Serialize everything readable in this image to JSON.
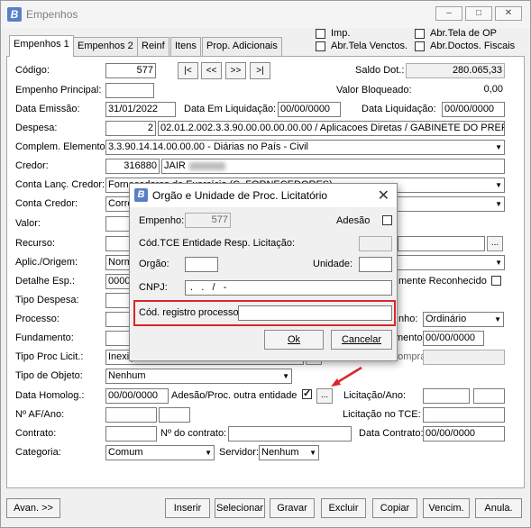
{
  "window": {
    "title": "Empenhos"
  },
  "top_checks": {
    "imp": "Imp.",
    "tela_vencto": "Abr.Tela Venctos.",
    "tela_op": "Abr.Tela de OP",
    "doctos_fiscais": "Abr.Doctos. Fiscais"
  },
  "tabs": [
    "Empenhos 1",
    "Empenhos 2",
    "Reinf",
    "Itens",
    "Prop. Adicionais"
  ],
  "form": {
    "codigo_label": "Código:",
    "codigo": "577",
    "nav": [
      "|<",
      "<<",
      ">>",
      ">|"
    ],
    "saldo_dot_label": "Saldo Dot.:",
    "saldo_dot": "280.065,33",
    "empenho_principal_label": "Empenho Principal:",
    "valor_bloqueado_label": "Valor Bloqueado:",
    "valor_bloqueado": "0,00",
    "data_emissao_label": "Data Emissão:",
    "data_emissao": "31/01/2022",
    "data_em_liquidacao_label": "Data Em Liquidação:",
    "data_em_liquidacao": "00/00/0000",
    "data_liquidacao_label": "Data Liquidação:",
    "data_liquidacao": "00/00/0000",
    "despesa_label": "Despesa:",
    "despesa_code": "2",
    "despesa_desc": "02.01.2.002.3.3.90.00.00.00.00.00 / Aplicacoes Diretas / GABINETE DO PREFI",
    "complem_label": "Complem. Elemento:",
    "complem": "3.3.90.14.14.00.00.00 - Diárias no País - Civil",
    "credor_label": "Credor:",
    "credor_code": "316880",
    "credor_name": "JAIR",
    "conta_lanc_label": "Conta Lanç. Credor:",
    "conta_lanc": "Fornecedores de Exercício (C. FORNECEDORES)",
    "conta_credor_label": "Conta Credor:",
    "conta_credor": "Corre",
    "valor_label": "Valor:",
    "recurso_label": "Recurso:",
    "aplic_label": "Aplic./Origem:",
    "aplic": "Norm",
    "detalhe_label": "Detalhe Esp.:",
    "detalhe": "0000",
    "reconhecido_label": "mente Reconhecido",
    "tipo_despesa_label": "Tipo Despesa:",
    "processo_label": "Processo:",
    "ordenamento_label": "nho:",
    "ordenamento": "Ordinário",
    "fundamento_label": "Fundamento:",
    "mento_label": "mento:",
    "mento_date": "00/00/0000",
    "tipo_proc_label": "Tipo Proc Licit.:",
    "tipo_proc": "Inexig",
    "compra_label": "Processo de Compra:",
    "tipo_objeto_label": "Tipo de Objeto:",
    "tipo_objeto": "Nenhum",
    "data_homolog_label": "Data Homolog.:",
    "data_homolog": "00/00/0000",
    "adesao_label": "Adesão/Proc. outra entidade",
    "licitacao_ano_label": "Licitação/Ano:",
    "af_ano_label": "Nº AF/Ano:",
    "licitacao_tce_label": "Licitação no TCE:",
    "contrato_label": "Contrato:",
    "n_contrato_label": "Nº do contrato:",
    "data_contrato_label": "Data Contrato:",
    "data_contrato": "00/00/0000",
    "categoria_label": "Categoria:",
    "categoria": "Comum",
    "servidor_label": "Servidor:",
    "servidor": "Nenhum"
  },
  "bottom_buttons": {
    "avan": "Avan. >>",
    "inserir": "Inserir",
    "selecionar": "Selecionar",
    "gravar": "Gravar",
    "excluir": "Excluir",
    "copiar": "Copiar",
    "vencim": "Vencim.",
    "anula": "Anula."
  },
  "dialog": {
    "title": "Orgão e Unidade de Proc. Licitatório",
    "empenho_label": "Empenho:",
    "empenho": "577",
    "adesao_label": "Adesão",
    "cod_tce_label": "Cód.TCE Entidade Resp. Licitação:",
    "orgao_label": "Orgão:",
    "unidade_label": "Unidade:",
    "cnpj_label": "CNPJ:",
    "cnpj": " .   .   /   -",
    "cod_registro_label": "Cód. registro processo:",
    "ok": "Ok",
    "cancelar": "Cancelar"
  },
  "colors": {
    "highlight": "#d9262b",
    "icon_blue": "#5b7fc7"
  }
}
